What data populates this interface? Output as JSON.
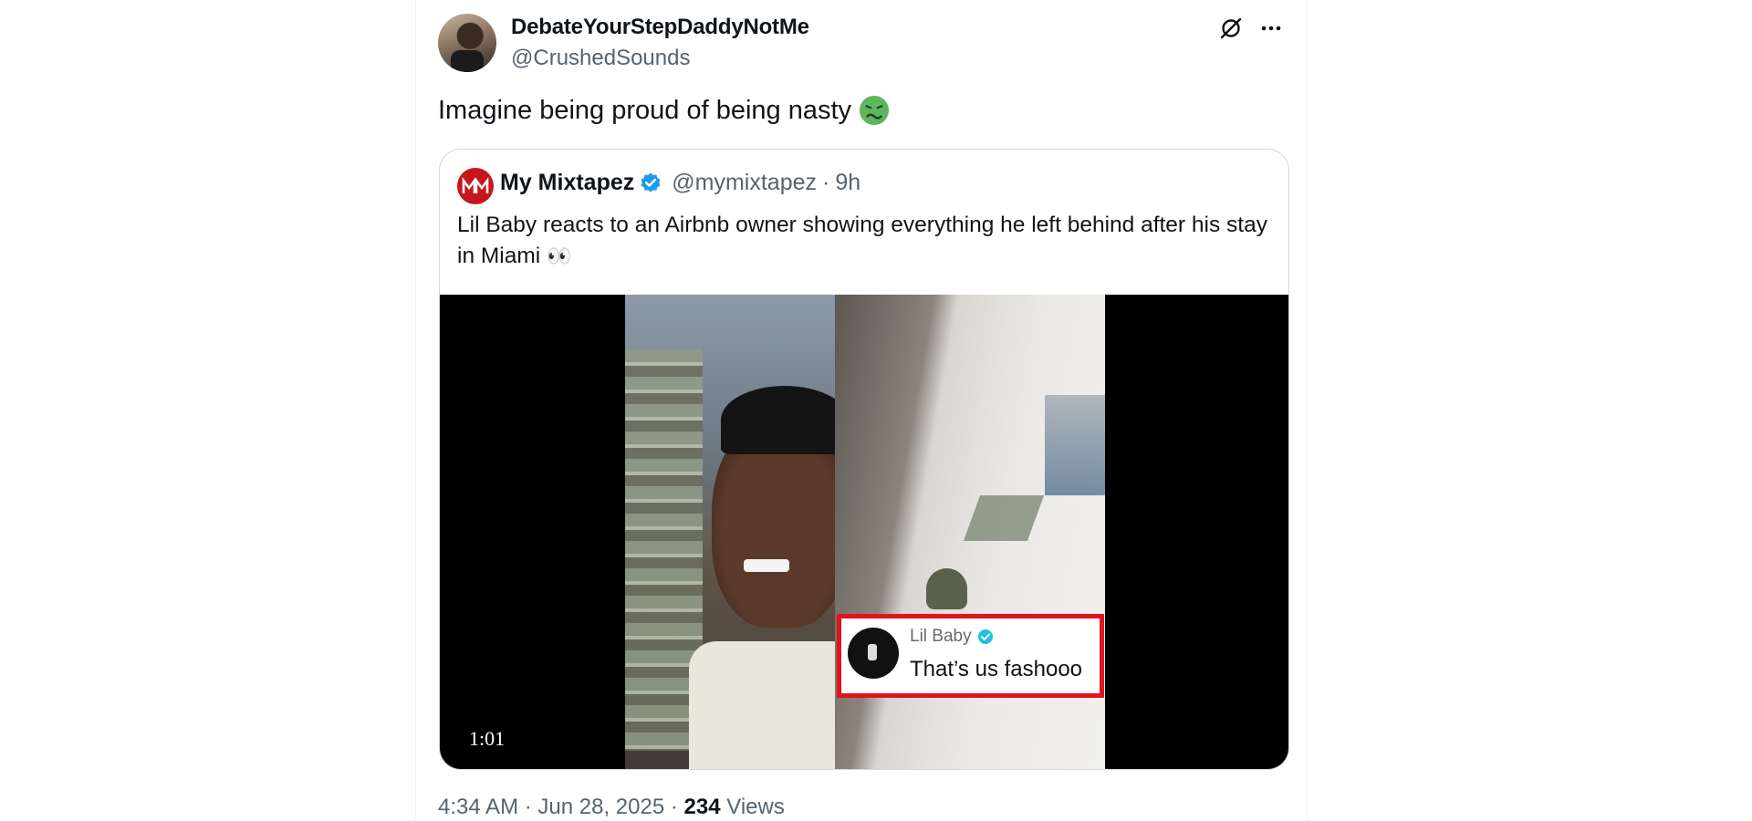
{
  "author": {
    "display_name": "DebateYourStepDaddyNotMe",
    "handle": "@CrushedSounds",
    "avatar_icon": "user-avatar"
  },
  "actions": {
    "grok_icon": "grok-icon",
    "more_icon": "more-icon"
  },
  "tweet": {
    "text": "Imagine being proud of being nasty",
    "emoji": "nauseated-face"
  },
  "quote": {
    "name": "My Mixtapez",
    "verified": true,
    "handle": "@mymixtapez",
    "separator": "·",
    "time": "9h",
    "text": "Lil Baby reacts to an Airbnb owner showing everything he left behind after his stay in Miami",
    "text_emoji": "👀",
    "media": {
      "type": "video",
      "duration": "1:01",
      "overlay_comment": {
        "name": "Lil Baby",
        "verified": true,
        "text": "That’s us fashooo"
      }
    }
  },
  "meta": {
    "time": "4:34 AM",
    "sep1": "·",
    "date": "Jun 28, 2025",
    "sep2": "·",
    "views_count": "234",
    "views_label": "Views"
  },
  "colors": {
    "text_primary": "#0f1419",
    "text_secondary": "#536471",
    "border": "#cfd9de",
    "verified_blue": "#1d9bf0",
    "highlight_red": "#e0131f"
  }
}
